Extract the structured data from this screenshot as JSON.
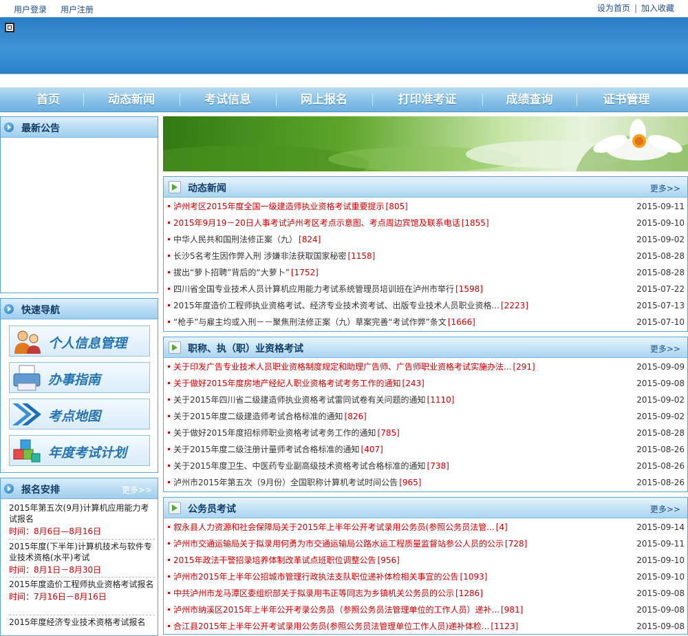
{
  "topbar": {
    "login": "用户登录",
    "register": "用户注册",
    "set_home": "设为首页",
    "separator": "|",
    "favorite": "加入收藏"
  },
  "nav": [
    "首页",
    "动态新闻",
    "考试信息",
    "网上报名",
    "打印准考证",
    "成绩查询",
    "证书管理"
  ],
  "announcements": {
    "title": "最新公告"
  },
  "quick_nav": {
    "title": "快速导航",
    "items": [
      "个人信息管理",
      "办事指南",
      "考点地图",
      "年度考试计划"
    ]
  },
  "schedule": {
    "title": "报名安排",
    "more": "更多>>",
    "items": [
      {
        "name": "2015年第五次(9月)计算机应用能力考试报名",
        "time": "时间：8月6日—8月16日"
      },
      {
        "name": "2015年度(下半年)计算机技术与软件专业技术资格(水平)考试",
        "time": "时间：8月1日－8月30日"
      },
      {
        "name": "2015年度造价工程师执业资格考试报名",
        "time": "时间：7月16日－8月16日"
      },
      {
        "name": "2015年度经济专业技术资格考试报名",
        "time": ""
      }
    ]
  },
  "news": {
    "title": "动态新闻",
    "more": "更多>>",
    "items": [
      {
        "title": "泸州考区2015年度全国一级建造师执业资格考试重要提示",
        "count": "[805]",
        "date": "2015-09-11",
        "red": true
      },
      {
        "title": "2015年9月19－20日人事考试泸州考区考点示意图、考点周边宾馆及联系电话",
        "count": "[1855]",
        "date": "2015-09-10",
        "red": true
      },
      {
        "title": "中华人民共和国刑法修正案（九）",
        "count": "[824]",
        "date": "2015-09-02",
        "red": false
      },
      {
        "title": "长沙5名考生因作弊入刑 涉嫌非法获取国家秘密",
        "count": "[1158]",
        "date": "2015-08-28",
        "red": false
      },
      {
        "title": "拔出“萝卜招聘”背后的“大萝卜”",
        "count": "[1752]",
        "date": "2015-08-28",
        "red": false
      },
      {
        "title": "四川省全国专业技术人员计算机应用能力考试系统管理员培训班在泸州市举行",
        "count": "[1598]",
        "date": "2015-07-22",
        "red": false
      },
      {
        "title": "2015年度造价工程师执业资格考试、经济专业技术资考试、出版专业技术人员职业资格...",
        "count": "[2223]",
        "date": "2015-07-13",
        "red": false
      },
      {
        "title": "“枪手”与雇主均或入刑－－聚焦刑法修正案（九）草案完善“考试作弊”条文",
        "count": "[1666]",
        "date": "2015-07-10",
        "red": false
      }
    ]
  },
  "qualification": {
    "title": "职称、执（职）业资格考试",
    "more": "更多>>",
    "items": [
      {
        "title": "关于印发广告专业技术人员职业资格制度规定和助理广告师、广告师职业资格考试实施办法...",
        "count": "[291]",
        "date": "2015-09-09",
        "red": true
      },
      {
        "title": "关于做好2015年度房地产经纪人职业资格考试考务工作的通知",
        "count": "[243]",
        "date": "2015-09-08",
        "red": true
      },
      {
        "title": "关于2015年四川省二级建造师执业资格考试雷同试卷有关问题的通知",
        "count": "[1110]",
        "date": "2015-09-02",
        "red": false
      },
      {
        "title": "关于2015年度二级建造师考试合格标准的通知",
        "count": "[826]",
        "date": "2015-09-02",
        "red": false
      },
      {
        "title": "关于做好2015年度招标师职业资格考试考务工作的通知",
        "count": "[785]",
        "date": "2015-08-28",
        "red": false
      },
      {
        "title": "关于2015年度二级注册计量师考试合格标准的通知",
        "count": "[407]",
        "date": "2015-08-26",
        "red": false
      },
      {
        "title": "关于2015年度卫生、中医药专业副高级技术资格考试合格标准的通知",
        "count": "[738]",
        "date": "2015-08-26",
        "red": false
      },
      {
        "title": "泸州市2015年第五次（9月份）全国职称计算机考试时间公告",
        "count": "[965]",
        "date": "2015-08-26",
        "red": false
      }
    ]
  },
  "civil": {
    "title": "公务员考试",
    "more": "更多>>",
    "items": [
      {
        "title": "叙永县人力资源和社会保障局关于2015年上半年公开考试录用公务员(参照公务员法管...",
        "count": "[4]",
        "date": "2015-09-14",
        "red": true
      },
      {
        "title": "泸州市交通运输局关于拟录用何勇为市交通运输局公路水运工程质量监督站参公人员的公示",
        "count": "[728]",
        "date": "2015-09-11",
        "red": true
      },
      {
        "title": "2015年政法干警招录培养体制改革试点班职位调整公告",
        "count": "[956]",
        "date": "2015-09-10",
        "red": true
      },
      {
        "title": "泸州市2015年上半年公招城市管理行政执法支队职位递补体检相关事宜的公告",
        "count": "[1093]",
        "date": "2015-09-10",
        "red": true
      },
      {
        "title": "中共泸州市龙马潭区委组织部关于拟录用韦正等同志为乡镇机关公务员的公示",
        "count": "[1286]",
        "date": "2015-09-08",
        "red": true
      },
      {
        "title": "泸州市纳溪区2015年上半年公开考录公务员（参照公务员法管理单位的工作人员）递补...",
        "count": "[981]",
        "date": "2015-09-08",
        "red": true
      },
      {
        "title": "合江县2015年上半年公开考试录用公务员(参照公务员法管理单位工作人员)递补体检...",
        "count": "[1123]",
        "date": "2015-09-08",
        "red": true
      }
    ]
  },
  "colors": {
    "accent": "#3e95d6",
    "red": "#cc0000",
    "nav_text": "#ffffff"
  }
}
